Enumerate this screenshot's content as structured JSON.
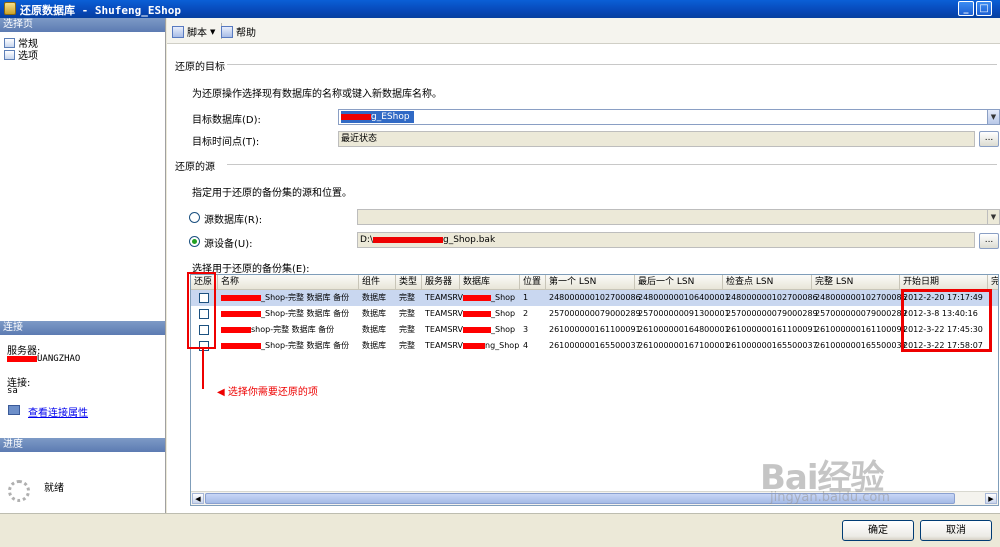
{
  "window": {
    "title": "还原数据库 - Shufeng_EShop"
  },
  "left": {
    "select_page_header": "选择页",
    "pages": [
      "常规",
      "选项"
    ],
    "connection_header": "连接",
    "server_label": "服务器:",
    "server_value": "UANGZHAO",
    "connect_label": "连接:",
    "connect_value": "sa",
    "view_conn_link": "查看连接属性",
    "progress_header": "进度",
    "ready": "就绪"
  },
  "toolbar": {
    "script": "脚本",
    "help": "帮助"
  },
  "target": {
    "group": "还原的目标",
    "desc": "为还原操作选择现有数据库的名称或键入新数据库名称。",
    "db_label": "目标数据库(D):",
    "db_value": "g_EShop",
    "time_label": "目标时间点(T):",
    "time_value": "最近状态"
  },
  "source": {
    "group": "还原的源",
    "desc": "指定用于还原的备份集的源和位置。",
    "from_db_label": "源数据库(R):",
    "from_dev_label": "源设备(U):",
    "device_value_prefix": "D:\\",
    "device_value_suffix": "g_Shop.bak",
    "backupset_label": "选择用于还原的备份集(E):"
  },
  "grid": {
    "headers": [
      "还原",
      "名称",
      "组件",
      "类型",
      "服务器",
      "数据库",
      "位置",
      "第一个 LSN",
      "最后一个 LSN",
      "检查点 LSN",
      "完整 LSN",
      "开始日期",
      "完"
    ],
    "rows": [
      {
        "name": "_Shop-完整 数据库 备份",
        "component": "数据库",
        "type": "完整",
        "server": "TEAMSRV",
        "database": "_Shop",
        "position": "1",
        "first_lsn": "248000000102700086",
        "last_lsn": "248000000106400001",
        "checkpoint_lsn": "248000000102700086",
        "full_lsn": "248000000102700086",
        "start_date": "2012-2-20 17:17:49"
      },
      {
        "name": "_Shop-完整 数据库 备份",
        "component": "数据库",
        "type": "完整",
        "server": "TEAMSRV",
        "database": "_Shop",
        "position": "2",
        "first_lsn": "257000000079000289",
        "last_lsn": "257000000091300001",
        "checkpoint_lsn": "257000000079000289",
        "full_lsn": "257000000079000289",
        "start_date": "2012-3-8 13:40:16"
      },
      {
        "name": "shop-完整 数据库 备份",
        "component": "数据库",
        "type": "完整",
        "server": "TEAMSRV",
        "database": "_Shop",
        "position": "3",
        "first_lsn": "261000000161100091",
        "last_lsn": "261000000164800001",
        "checkpoint_lsn": "261000000161100091",
        "full_lsn": "261000000161100091",
        "start_date": "2012-3-22 17:45:30"
      },
      {
        "name": "_Shop-完整 数据库 备份",
        "component": "数据库",
        "type": "完整",
        "server": "TEAMSRV",
        "database": "ng_Shop",
        "position": "4",
        "first_lsn": "261000000165500037",
        "last_lsn": "261000000167100001",
        "checkpoint_lsn": "261000000165500037",
        "full_lsn": "261000000165500037",
        "start_date": "2012-3-22 17:58:07"
      }
    ]
  },
  "annotation": "选择你需要还原的项",
  "buttons": {
    "ok": "确定",
    "cancel": "取消"
  },
  "watermark": {
    "brand": "Bai经验",
    "url": "jingyan.baidu.com"
  }
}
